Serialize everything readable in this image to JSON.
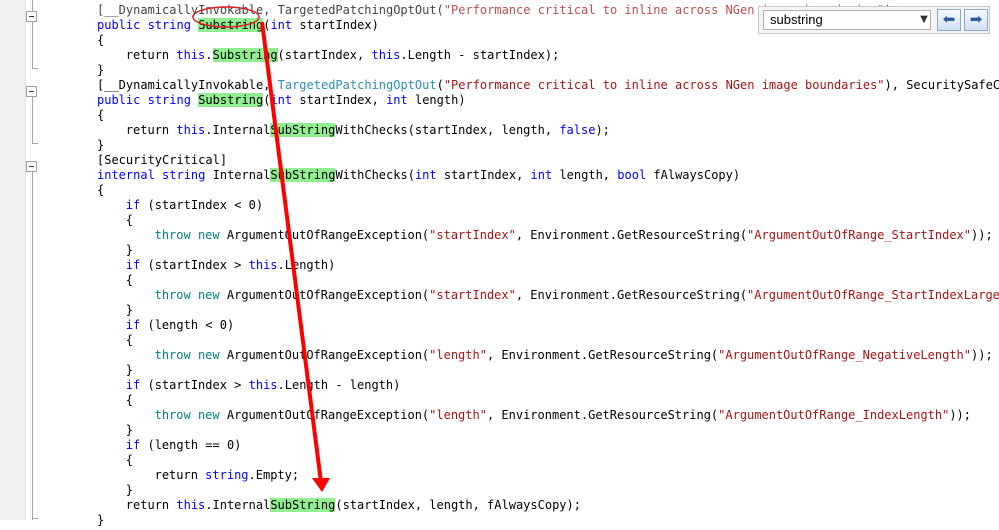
{
  "search": {
    "value": "substring",
    "dropdown_icon": "chevron-down-icon",
    "back_icon": "arrow-left-icon",
    "forward_icon": "arrow-right-icon"
  },
  "code": {
    "lines": [
      {
        "i": 0,
        "indent": 0,
        "segments": [
          {
            "t": "[__DynamicallyInvokable, TargetedPatchingOptOut(",
            "c": "plain"
          },
          {
            "t": "\"Performance critical to inline across NGen image boundaries\"",
            "c": "str"
          },
          {
            "t": ")",
            "c": "plain"
          }
        ]
      },
      {
        "i": 1,
        "indent": 0,
        "segments": [
          {
            "t": "public",
            "c": "kw"
          },
          {
            "t": " ",
            "c": "plain"
          },
          {
            "t": "string",
            "c": "kw"
          },
          {
            "t": " ",
            "c": "plain"
          },
          {
            "t": "Substring",
            "c": "hl"
          },
          {
            "t": "(",
            "c": "plain"
          },
          {
            "t": "int",
            "c": "kw"
          },
          {
            "t": " startIndex)",
            "c": "plain"
          }
        ]
      },
      {
        "i": 2,
        "indent": 0,
        "segments": [
          {
            "t": "{",
            "c": "plain"
          }
        ]
      },
      {
        "i": 3,
        "indent": 4,
        "segments": [
          {
            "t": "return ",
            "c": "plain"
          },
          {
            "t": "this",
            "c": "kw"
          },
          {
            "t": ".",
            "c": "plain"
          },
          {
            "t": "Substring",
            "c": "hl"
          },
          {
            "t": "(startIndex, ",
            "c": "plain"
          },
          {
            "t": "this",
            "c": "kw"
          },
          {
            "t": ".Length - startIndex);",
            "c": "plain"
          }
        ]
      },
      {
        "i": 4,
        "indent": 0,
        "segments": [
          {
            "t": "}",
            "c": "plain"
          }
        ]
      },
      {
        "i": 5,
        "indent": 0,
        "segments": [
          {
            "t": "[__DynamicallyInvokable, ",
            "c": "plain"
          },
          {
            "t": "TargetedPatchingOptOut",
            "c": "attr"
          },
          {
            "t": "(",
            "c": "plain"
          },
          {
            "t": "\"Performance critical to inline across NGen image boundaries\"",
            "c": "str"
          },
          {
            "t": "), SecuritySafeCriti",
            "c": "plain"
          }
        ]
      },
      {
        "i": 6,
        "indent": 0,
        "segments": [
          {
            "t": "public",
            "c": "kw"
          },
          {
            "t": " ",
            "c": "plain"
          },
          {
            "t": "string",
            "c": "kw"
          },
          {
            "t": " ",
            "c": "plain"
          },
          {
            "t": "Substring",
            "c": "hl"
          },
          {
            "t": "(",
            "c": "plain"
          },
          {
            "t": "int",
            "c": "kw"
          },
          {
            "t": " startIndex, ",
            "c": "plain"
          },
          {
            "t": "int",
            "c": "kw"
          },
          {
            "t": " length)",
            "c": "plain"
          }
        ]
      },
      {
        "i": 7,
        "indent": 0,
        "segments": [
          {
            "t": "{",
            "c": "plain"
          }
        ]
      },
      {
        "i": 8,
        "indent": 4,
        "segments": [
          {
            "t": "return ",
            "c": "plain"
          },
          {
            "t": "this",
            "c": "kw"
          },
          {
            "t": ".Internal",
            "c": "plain"
          },
          {
            "t": "SubString",
            "c": "hl"
          },
          {
            "t": "WithChecks(startIndex, length, ",
            "c": "plain"
          },
          {
            "t": "false",
            "c": "kw"
          },
          {
            "t": ");",
            "c": "plain"
          }
        ]
      },
      {
        "i": 9,
        "indent": 0,
        "segments": [
          {
            "t": "}",
            "c": "plain"
          }
        ]
      },
      {
        "i": 10,
        "indent": 0,
        "segments": [
          {
            "t": "[SecurityCritical]",
            "c": "plain"
          }
        ]
      },
      {
        "i": 11,
        "indent": 0,
        "segments": [
          {
            "t": "internal",
            "c": "kw"
          },
          {
            "t": " ",
            "c": "plain"
          },
          {
            "t": "string",
            "c": "kw"
          },
          {
            "t": " Internal",
            "c": "plain"
          },
          {
            "t": "SubString",
            "c": "hl"
          },
          {
            "t": "WithChecks(",
            "c": "plain"
          },
          {
            "t": "int",
            "c": "kw"
          },
          {
            "t": " startIndex, ",
            "c": "plain"
          },
          {
            "t": "int",
            "c": "kw"
          },
          {
            "t": " length, ",
            "c": "plain"
          },
          {
            "t": "bool",
            "c": "kw"
          },
          {
            "t": " fAlwaysCopy)",
            "c": "plain"
          }
        ]
      },
      {
        "i": 12,
        "indent": 0,
        "segments": [
          {
            "t": "{",
            "c": "plain"
          }
        ]
      },
      {
        "i": 13,
        "indent": 4,
        "segments": [
          {
            "t": "if",
            "c": "kw"
          },
          {
            "t": " (startIndex < 0)",
            "c": "plain"
          }
        ]
      },
      {
        "i": 14,
        "indent": 4,
        "segments": [
          {
            "t": "{",
            "c": "plain"
          }
        ]
      },
      {
        "i": 15,
        "indent": 8,
        "segments": [
          {
            "t": "throw",
            "c": "kt"
          },
          {
            "t": " ",
            "c": "plain"
          },
          {
            "t": "new",
            "c": "kt"
          },
          {
            "t": " ArgumentOutOfRangeException(",
            "c": "plain"
          },
          {
            "t": "\"startIndex\"",
            "c": "str"
          },
          {
            "t": ", Environment.GetResourceString(",
            "c": "plain"
          },
          {
            "t": "\"ArgumentOutOfRange_StartIndex\"",
            "c": "str"
          },
          {
            "t": "));",
            "c": "plain"
          }
        ]
      },
      {
        "i": 16,
        "indent": 4,
        "segments": [
          {
            "t": "}",
            "c": "plain"
          }
        ]
      },
      {
        "i": 17,
        "indent": 4,
        "segments": [
          {
            "t": "if",
            "c": "kw"
          },
          {
            "t": " (startIndex > ",
            "c": "plain"
          },
          {
            "t": "this",
            "c": "kw"
          },
          {
            "t": ".Length)",
            "c": "plain"
          }
        ]
      },
      {
        "i": 18,
        "indent": 4,
        "segments": [
          {
            "t": "{",
            "c": "plain"
          }
        ]
      },
      {
        "i": 19,
        "indent": 8,
        "segments": [
          {
            "t": "throw",
            "c": "kt"
          },
          {
            "t": " ",
            "c": "plain"
          },
          {
            "t": "new",
            "c": "kt"
          },
          {
            "t": " ArgumentOutOfRangeException(",
            "c": "plain"
          },
          {
            "t": "\"startIndex\"",
            "c": "str"
          },
          {
            "t": ", Environment.GetResourceString(",
            "c": "plain"
          },
          {
            "t": "\"ArgumentOutOfRange_StartIndexLargerTha",
            "c": "str"
          }
        ]
      },
      {
        "i": 20,
        "indent": 4,
        "segments": [
          {
            "t": "}",
            "c": "plain"
          }
        ]
      },
      {
        "i": 21,
        "indent": 4,
        "segments": [
          {
            "t": "if",
            "c": "kw"
          },
          {
            "t": " (length < 0)",
            "c": "plain"
          }
        ]
      },
      {
        "i": 22,
        "indent": 4,
        "segments": [
          {
            "t": "{",
            "c": "plain"
          }
        ]
      },
      {
        "i": 23,
        "indent": 8,
        "segments": [
          {
            "t": "throw",
            "c": "kt"
          },
          {
            "t": " ",
            "c": "plain"
          },
          {
            "t": "new",
            "c": "kt"
          },
          {
            "t": " ArgumentOutOfRangeException(",
            "c": "plain"
          },
          {
            "t": "\"length\"",
            "c": "str"
          },
          {
            "t": ", Environment.GetResourceString(",
            "c": "plain"
          },
          {
            "t": "\"ArgumentOutOfRange_NegativeLength\"",
            "c": "str"
          },
          {
            "t": "));",
            "c": "plain"
          }
        ]
      },
      {
        "i": 24,
        "indent": 4,
        "segments": [
          {
            "t": "}",
            "c": "plain"
          }
        ]
      },
      {
        "i": 25,
        "indent": 4,
        "segments": [
          {
            "t": "if",
            "c": "kw"
          },
          {
            "t": " (startIndex > ",
            "c": "plain"
          },
          {
            "t": "this",
            "c": "kw"
          },
          {
            "t": ".Length - length)",
            "c": "plain"
          }
        ]
      },
      {
        "i": 26,
        "indent": 4,
        "segments": [
          {
            "t": "{",
            "c": "plain"
          }
        ]
      },
      {
        "i": 27,
        "indent": 8,
        "segments": [
          {
            "t": "throw",
            "c": "kt"
          },
          {
            "t": " ",
            "c": "plain"
          },
          {
            "t": "new",
            "c": "kt"
          },
          {
            "t": " ArgumentOutOfRangeException(",
            "c": "plain"
          },
          {
            "t": "\"length\"",
            "c": "str"
          },
          {
            "t": ", Environment.GetResourceString(",
            "c": "plain"
          },
          {
            "t": "\"ArgumentOutOfRange_IndexLength\"",
            "c": "str"
          },
          {
            "t": "));",
            "c": "plain"
          }
        ]
      },
      {
        "i": 28,
        "indent": 4,
        "segments": [
          {
            "t": "}",
            "c": "plain"
          }
        ]
      },
      {
        "i": 29,
        "indent": 4,
        "segments": [
          {
            "t": "if",
            "c": "kw"
          },
          {
            "t": " (length == 0)",
            "c": "plain"
          }
        ]
      },
      {
        "i": 30,
        "indent": 4,
        "segments": [
          {
            "t": "{",
            "c": "plain"
          }
        ]
      },
      {
        "i": 31,
        "indent": 8,
        "segments": [
          {
            "t": "return ",
            "c": "plain"
          },
          {
            "t": "string",
            "c": "kw"
          },
          {
            "t": ".Empty;",
            "c": "plain"
          }
        ]
      },
      {
        "i": 32,
        "indent": 4,
        "segments": [
          {
            "t": "}",
            "c": "plain"
          }
        ]
      },
      {
        "i": 33,
        "indent": 4,
        "segments": [
          {
            "t": "return ",
            "c": "plain"
          },
          {
            "t": "this",
            "c": "kw"
          },
          {
            "t": ".Internal",
            "c": "plain"
          },
          {
            "t": "SubString",
            "c": "hl"
          },
          {
            "t": "(startIndex, length, fAlwaysCopy);",
            "c": "plain"
          }
        ]
      },
      {
        "i": 34,
        "indent": 0,
        "segments": [
          {
            "t": "}",
            "c": "plain"
          }
        ]
      }
    ]
  }
}
